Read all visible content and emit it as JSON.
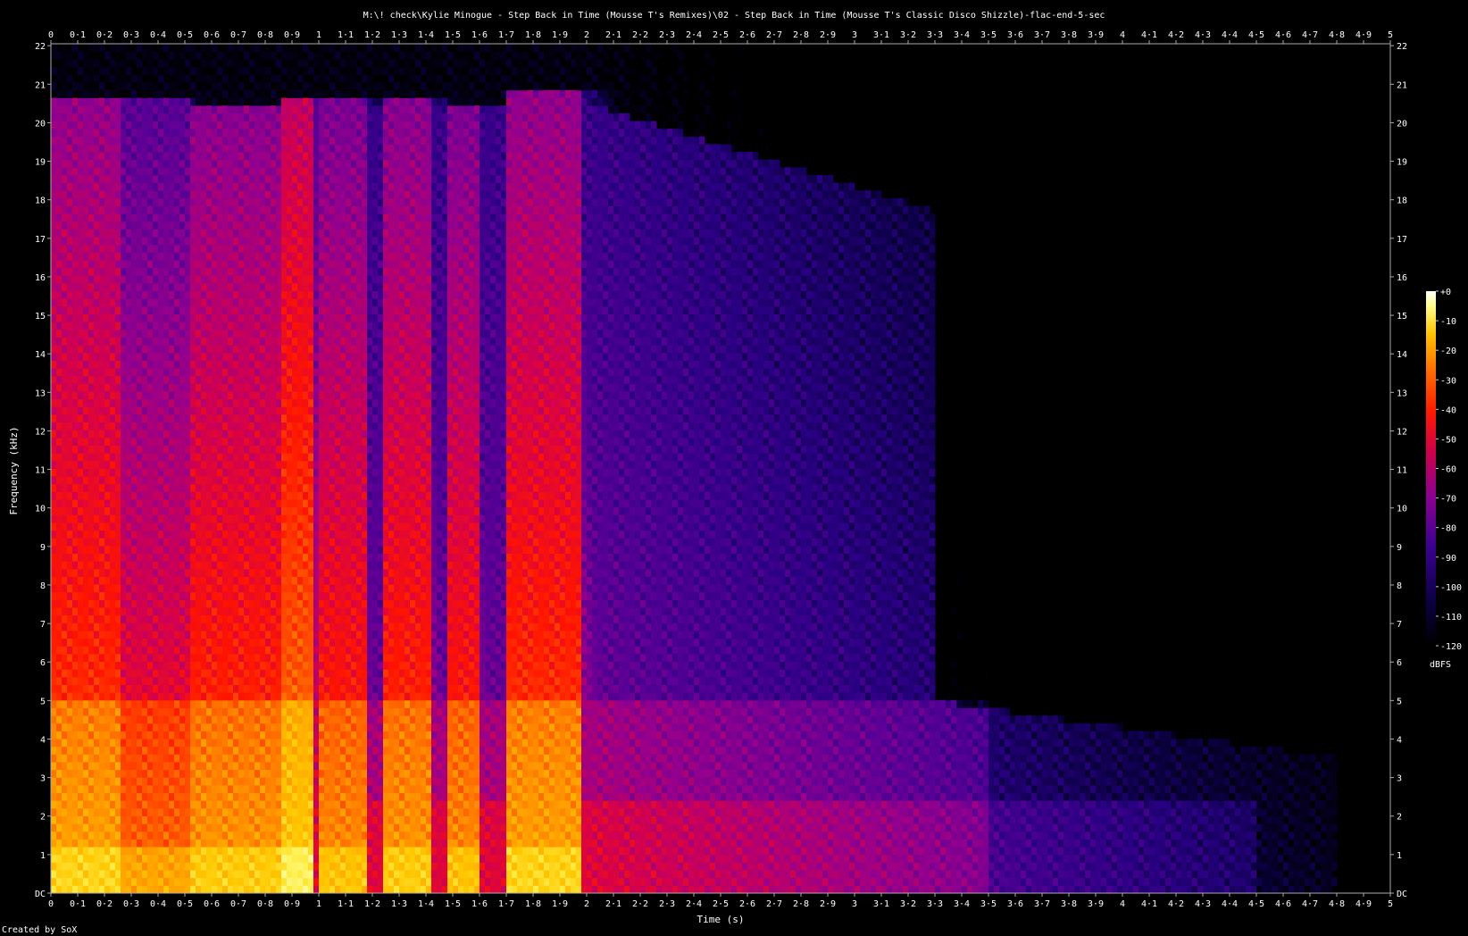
{
  "chart_data": {
    "type": "heatmap",
    "title": "M:\\! check\\Kylie Minogue - Step Back in Time (Mousse T's Remixes)\\02 - Step Back in Time (Mousse T's Classic Disco Shizzle)-flac-end-5-sec",
    "xlabel": "Time (s)",
    "ylabel": "Frequency (kHz)",
    "xlim": [
      0,
      5
    ],
    "ylim": [
      0,
      22.05
    ],
    "x_ticks": [
      "0",
      "0·1",
      "0·2",
      "0·3",
      "0·4",
      "0·5",
      "0·6",
      "0·7",
      "0·8",
      "0·9",
      "1",
      "1·1",
      "1·2",
      "1·3",
      "1·4",
      "1·5",
      "1·6",
      "1·7",
      "1·8",
      "1·9",
      "2",
      "2·1",
      "2·2",
      "2·3",
      "2·4",
      "2·5",
      "2·6",
      "2·7",
      "2·8",
      "2·9",
      "3",
      "3·1",
      "3·2",
      "3·3",
      "3·4",
      "3·5",
      "3·6",
      "3·7",
      "3·8",
      "3·9",
      "4",
      "4·1",
      "4·2",
      "4·3",
      "4·4",
      "4·5",
      "4·6",
      "4·7",
      "4·8",
      "4·9",
      "5"
    ],
    "y_ticks": [
      "DC",
      "1",
      "2",
      "3",
      "4",
      "5",
      "6",
      "7",
      "8",
      "9",
      "10",
      "11",
      "12",
      "13",
      "14",
      "15",
      "16",
      "17",
      "18",
      "19",
      "20",
      "21",
      "22"
    ],
    "colorbar": {
      "label": "dBFS",
      "ticks": [
        "+0",
        "-10",
        "-20",
        "-30",
        "-40",
        "-50",
        "-60",
        "-70",
        "-80",
        "-90",
        "-100",
        "-110",
        "-120"
      ],
      "range": [
        -120,
        0
      ]
    },
    "bursts": [
      {
        "t0": 0.0,
        "t1": 0.26,
        "fmax": 20.7,
        "level": -48
      },
      {
        "t0": 0.26,
        "t1": 0.52,
        "fmax": 20.6,
        "level": -58
      },
      {
        "t0": 0.52,
        "t1": 0.86,
        "fmax": 20.5,
        "level": -50
      },
      {
        "t0": 0.86,
        "t1": 0.98,
        "fmax": 20.7,
        "level": -40
      },
      {
        "t0": 1.0,
        "t1": 1.17,
        "fmax": 20.6,
        "level": -52
      },
      {
        "t0": 1.24,
        "t1": 1.42,
        "fmax": 20.6,
        "level": -50
      },
      {
        "t0": 1.49,
        "t1": 1.6,
        "fmax": 20.5,
        "level": -52
      },
      {
        "t0": 1.7,
        "t1": 1.98,
        "fmax": 20.8,
        "level": -48
      }
    ],
    "decay": {
      "start": 2.0,
      "end": 4.8,
      "level_start": -85,
      "level_end": -115
    },
    "colors": {
      "background": "#000000",
      "low": "#000030",
      "mid": "#b0008a",
      "high": "#ff2000",
      "peak": "#ffff90"
    }
  },
  "footer": {
    "credit": "Created by SoX"
  }
}
